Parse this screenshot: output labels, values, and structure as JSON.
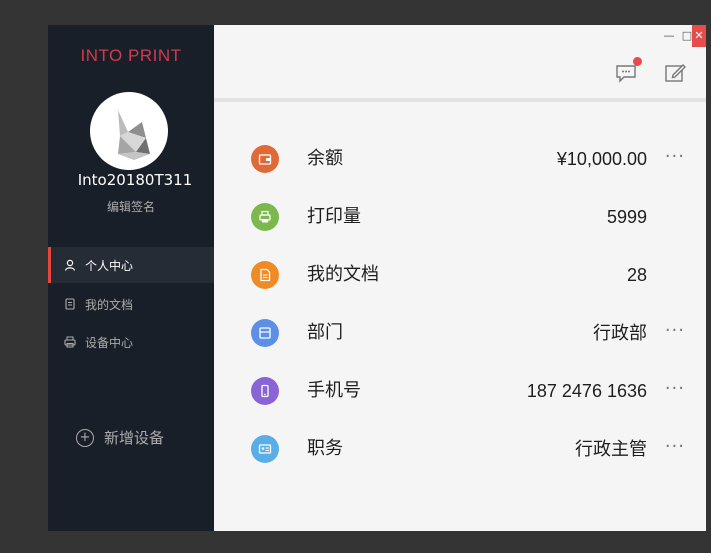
{
  "sidebar": {
    "brand": "INTO PRINT",
    "username": "Into20180T311",
    "signature": "编辑签名",
    "nav": [
      {
        "label": "个人中心",
        "icon": "user-icon",
        "active": true,
        "color": "#fffefe"
      },
      {
        "label": "我的文档",
        "icon": "document-icon",
        "active": false,
        "color": "#acacac"
      },
      {
        "label": "设备中心",
        "icon": "printer-icon",
        "active": false,
        "color": "#acacac"
      }
    ],
    "add_device": "新增设备",
    "background": "#191f28"
  },
  "window": {
    "minimize": "—",
    "maximize": "□",
    "close": "✕"
  },
  "rows": [
    {
      "label": "余额",
      "value": "¥10,000.00",
      "icon": "wallet-icon",
      "color": "#e06a37",
      "more": "···"
    },
    {
      "label": "打印量",
      "value": "5999",
      "icon": "print-count-icon",
      "color": "#7cb84e",
      "more": ""
    },
    {
      "label": "我的文档",
      "value": "28",
      "icon": "document-icon",
      "color": "#f08a24",
      "more": ""
    },
    {
      "label": "部门",
      "value": "行政部",
      "icon": "department-icon",
      "color": "#5c8fe6",
      "more": "···"
    },
    {
      "label": "手机号",
      "value": "187 2476 1636",
      "icon": "phone-icon",
      "color": "#8a64d6",
      "more": "···"
    },
    {
      "label": "职务",
      "value": "行政主管",
      "icon": "id-card-icon",
      "color": "#5aaee8",
      "more": "···"
    }
  ]
}
